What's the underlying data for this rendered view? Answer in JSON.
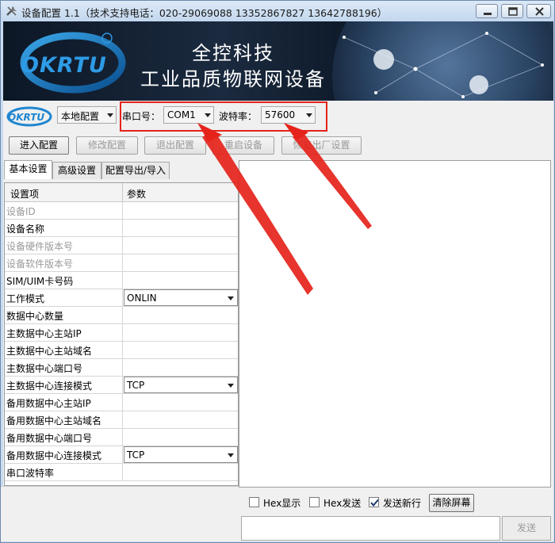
{
  "window": {
    "title": "设备配置 1.1（技术支持电话：020-29069088  13352867827 13642788196）"
  },
  "banner": {
    "logo_text": "OKRTU",
    "line1": "全控科技",
    "line2": "工业品质物联网设备"
  },
  "toolbar": {
    "mode_select": "本地配置",
    "port_label": "串口号：",
    "port_value": "COM1",
    "baud_label": "波特率：",
    "baud_value": "57600"
  },
  "buttons": {
    "enter": "进入配置",
    "modify": "修改配置",
    "exit": "退出配置",
    "restart": "重启设备",
    "factory": "恢复出厂设置"
  },
  "tabs": [
    "基本设置",
    "高级设置",
    "配置导出/导入"
  ],
  "grid": {
    "col_name": "设置项",
    "col_value": "参数",
    "rows": [
      {
        "name": "设备ID",
        "value": "",
        "dim": true
      },
      {
        "name": "设备名称",
        "value": ""
      },
      {
        "name": "设备硬件版本号",
        "value": "",
        "dim": true
      },
      {
        "name": "设备软件版本号",
        "value": "",
        "dim": true
      },
      {
        "name": "SIM/UIM卡号码",
        "value": ""
      },
      {
        "name": "工作模式",
        "value": "ONLIN",
        "dropdown": true
      },
      {
        "name": "数据中心数量",
        "value": ""
      },
      {
        "name": "主数据中心主站IP",
        "value": ""
      },
      {
        "name": "主数据中心主站域名",
        "value": ""
      },
      {
        "name": "主数据中心端口号",
        "value": ""
      },
      {
        "name": "主数据中心连接模式",
        "value": "TCP",
        "dropdown": true
      },
      {
        "name": "备用数据中心主站IP",
        "value": ""
      },
      {
        "name": "备用数据中心主站域名",
        "value": ""
      },
      {
        "name": "备用数据中心端口号",
        "value": ""
      },
      {
        "name": "备用数据中心连接模式",
        "value": "TCP",
        "dropdown": true
      },
      {
        "name": "串口波特率",
        "value": ""
      }
    ]
  },
  "bottom": {
    "hex_display": "Hex显示",
    "hex_display_checked": false,
    "hex_send": "Hex发送",
    "hex_send_checked": false,
    "newline": "发送新行",
    "newline_checked": true,
    "clear": "清除屏幕",
    "send": "发送"
  },
  "colors": {
    "annotation_red": "#e5231b",
    "banner_dark": "#0c1726"
  }
}
